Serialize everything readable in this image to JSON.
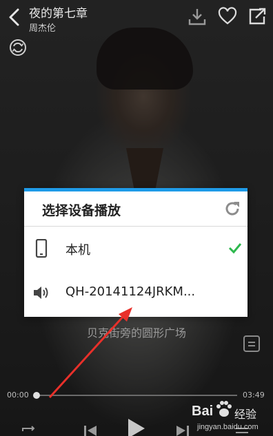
{
  "song": {
    "title": "夜的第七章",
    "artist": "周杰伦"
  },
  "lyric": "贝克街旁的圆形广场",
  "player": {
    "current_time": "00:00",
    "total_time": "03:49",
    "progress": 0.0
  },
  "dialog": {
    "title": "选择设备播放",
    "devices": [
      {
        "label": "本机",
        "icon": "phone-icon",
        "selected": true
      },
      {
        "label": "QH-20141124JRKM...",
        "icon": "speaker-icon",
        "selected": false
      }
    ]
  },
  "watermark": {
    "brand": "Bai",
    "brand_suffix": "经验",
    "url": "jingyan.baidu.com"
  },
  "colors": {
    "accent": "#1e9be8",
    "check": "#2db84d",
    "arrow": "#e8302a"
  }
}
